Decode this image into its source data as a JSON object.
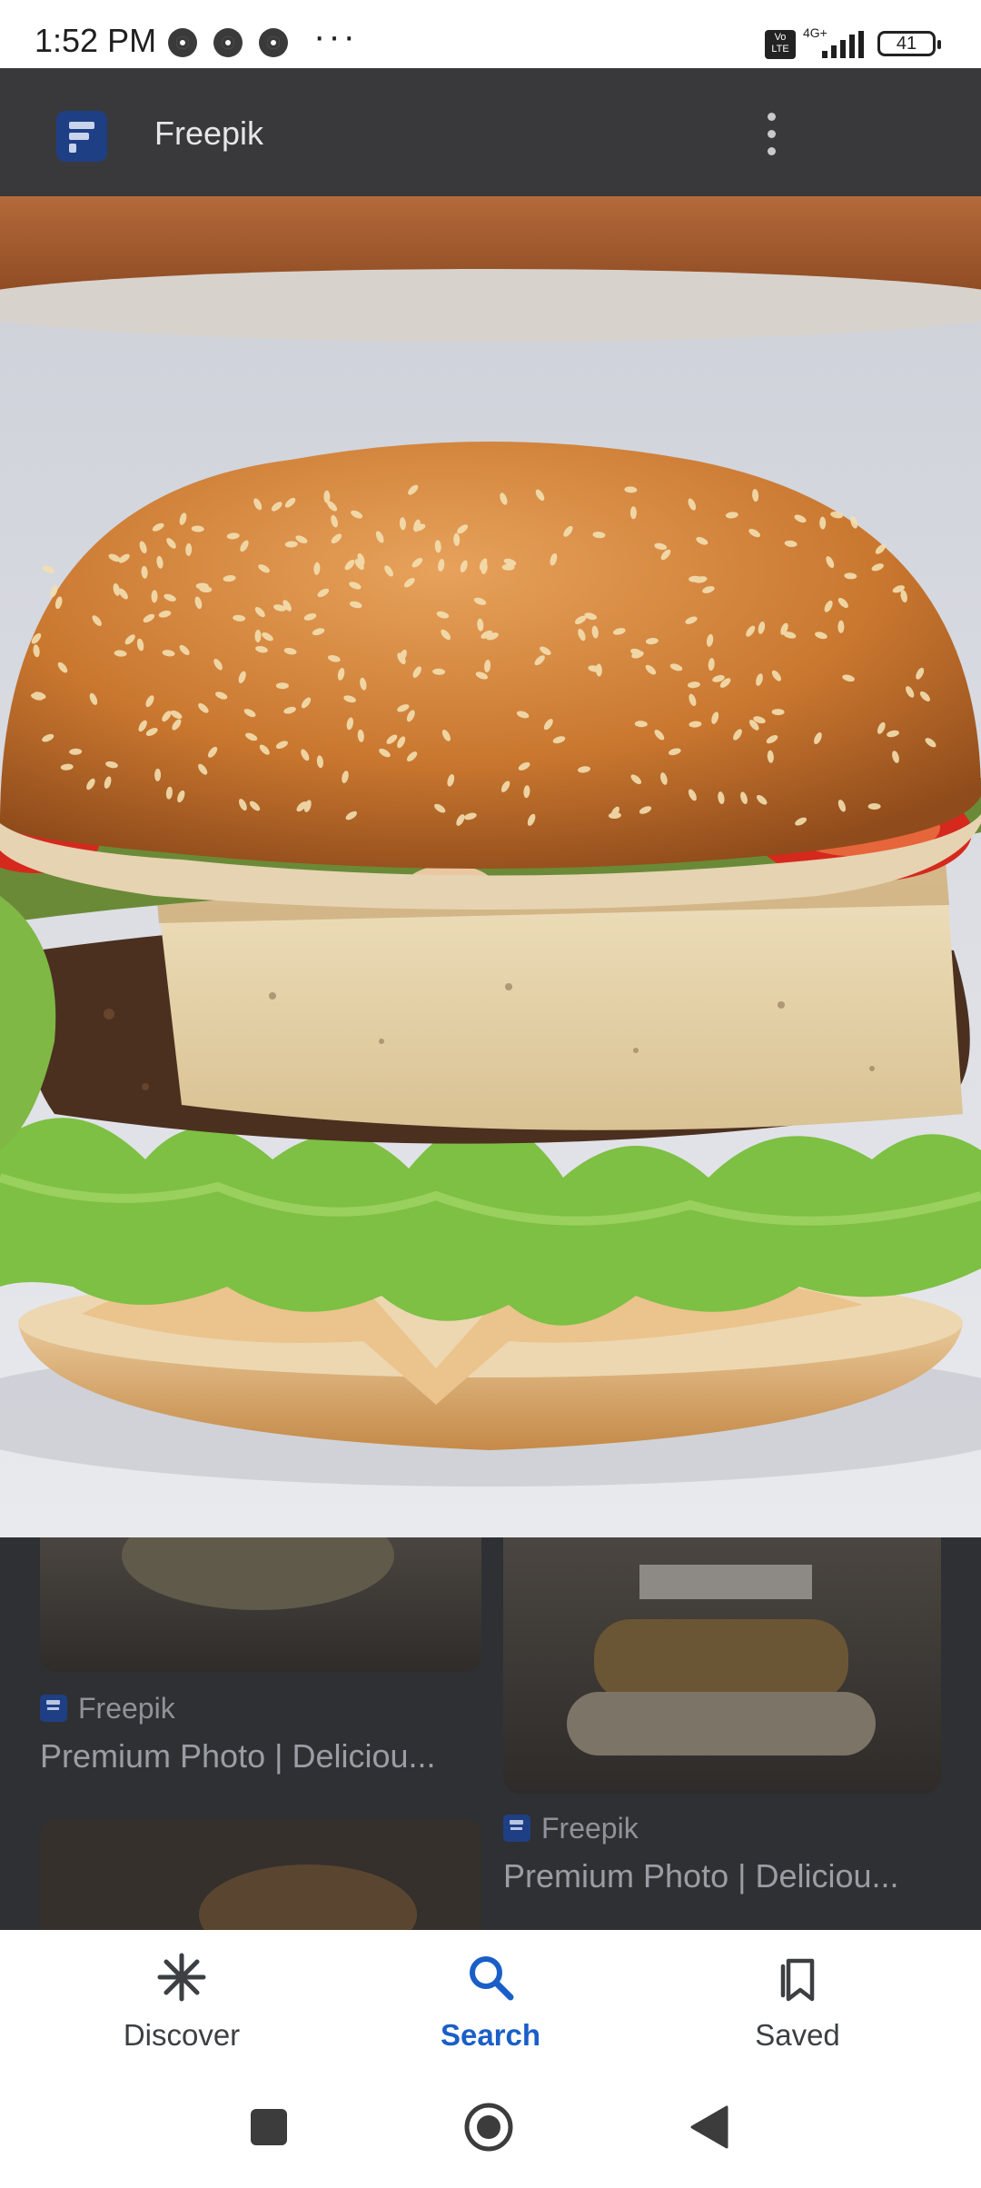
{
  "status_bar": {
    "time": "1:52 PM",
    "network_label": "4G+",
    "volte_label": "Vo LTE",
    "battery": "41",
    "overflow": "···"
  },
  "header": {
    "site_name": "Freepik",
    "logo_icon": "freepik-logo",
    "menu_icon": "more-vert-icon"
  },
  "results": [
    {
      "source": "Freepik",
      "title": "Premium Photo | Deliciou..."
    },
    {
      "source": "Freepik",
      "title": "Premium Photo | Deliciou..."
    }
  ],
  "bottom_nav": {
    "items": [
      {
        "label": "Discover",
        "icon": "asterisk-icon",
        "active": false
      },
      {
        "label": "Search",
        "icon": "search-icon",
        "active": true
      },
      {
        "label": "Saved",
        "icon": "bookmarks-icon",
        "active": false
      }
    ],
    "active_color": "#1a5fc7"
  },
  "system_nav": {
    "items": [
      "recents-button",
      "home-button",
      "back-button"
    ]
  }
}
